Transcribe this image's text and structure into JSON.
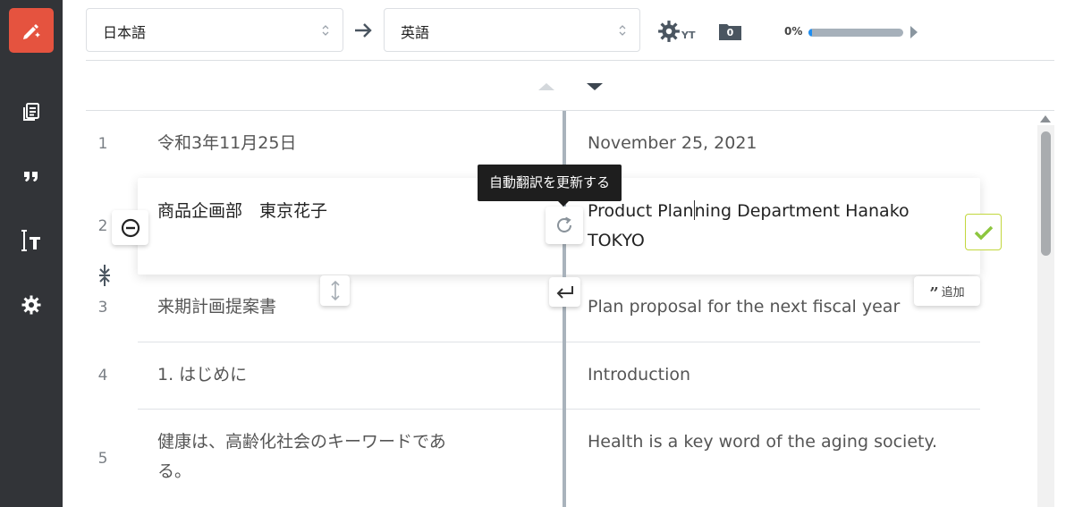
{
  "header": {
    "source_language": "日本語",
    "target_language": "英語",
    "settings_badge": "YT",
    "folder_count": "0",
    "progress_label": "0%",
    "progress_value": 0.04
  },
  "rows": [
    {
      "num": "1",
      "source": "令和3年11月25日",
      "target": "November 25, 2021"
    },
    {
      "num": "2",
      "source": "商品企画部　東京花子",
      "target_before_cursor": "Product Plan",
      "target_after_cursor": "ning Department Hanako",
      "target_line2": "TOKYO"
    },
    {
      "num": "3",
      "source": "来期計画提案書",
      "target": "Plan proposal for the next fiscal year"
    },
    {
      "num": "4",
      "source": "1. はじめに",
      "target": "Introduction"
    },
    {
      "num": "5",
      "source_line1": "健康は、高齢化社会のキーワードであ",
      "source_line2": "る。",
      "target": "Health is a key word of the aging society."
    }
  ],
  "tooltip": "自動翻訳を更新する",
  "add_button_label": "追加",
  "icons": {
    "logo": "pen-sparkle-icon",
    "nav": [
      "document-icon",
      "quote-icon",
      "text-cursor-icon",
      "gear-icon"
    ],
    "header": [
      "arrow-right-icon",
      "gear-icon",
      "folder-icon",
      "play-icon"
    ],
    "row_actions": [
      "minus-circle-icon",
      "refresh-icon",
      "resize-vertical-icon",
      "return-icon",
      "check-icon",
      "merge-icon"
    ]
  },
  "colors": {
    "sidebar": "#323438",
    "logo": "#e5533f",
    "progress": "#1e8ef2",
    "confirm": "#8dc63f"
  }
}
